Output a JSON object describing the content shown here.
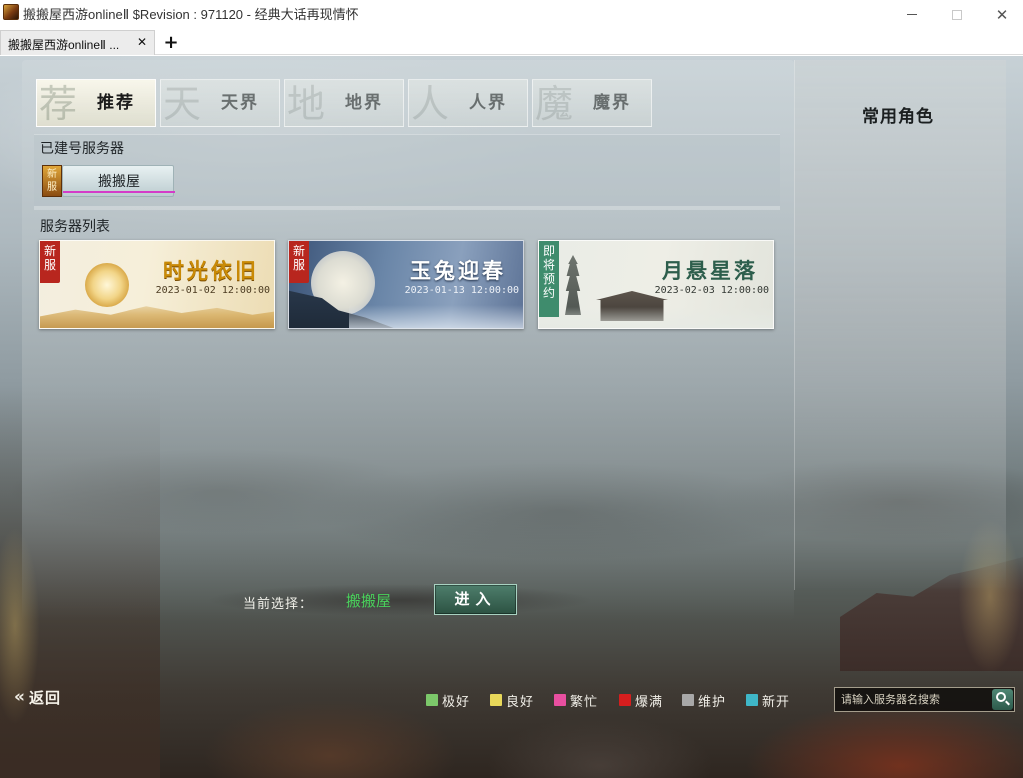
{
  "window": {
    "title": "搬搬屋西游onlineⅡ  $Revision : 971120 - 经典大话再现情怀",
    "minimize_icon": "minimize-icon",
    "maximize_icon": "maximize-icon",
    "close_glyph": "✕"
  },
  "tabs": [
    {
      "label": "搬搬屋西游onlineⅡ ...",
      "close": "✕"
    }
  ],
  "new_tab_glyph": "+",
  "realm_tabs": [
    {
      "watermark": "荐",
      "label": "推荐",
      "active": true
    },
    {
      "watermark": "天",
      "label": "天界",
      "active": false
    },
    {
      "watermark": "地",
      "label": "地界",
      "active": false
    },
    {
      "watermark": "人",
      "label": "人界",
      "active": false
    },
    {
      "watermark": "魔",
      "label": "魔界",
      "active": false
    }
  ],
  "built_section": {
    "title": "已建号服务器",
    "server": {
      "badge": "新服",
      "name": "搬搬屋"
    }
  },
  "list_section": {
    "title": "服务器列表",
    "servers": [
      {
        "badge": "新服",
        "badge_type": "new",
        "title": "时光依旧",
        "time": "2023-01-02 12:00:00"
      },
      {
        "badge": "新服",
        "badge_type": "new",
        "title": "玉兔迎春",
        "time": "2023-01-13 12:00:00"
      },
      {
        "badge": "即将预约",
        "badge_type": "soon",
        "title": "月悬星落",
        "time": "2023-02-03 12:00:00"
      }
    ]
  },
  "side_panel": {
    "title": "常用角色"
  },
  "selection": {
    "label": "当前选择：",
    "value": "搬搬屋",
    "enter_label": "进入"
  },
  "footer": {
    "back_icon": "«",
    "back_label": "返回",
    "legend": [
      {
        "label": "极好",
        "color": "#7cc86a"
      },
      {
        "label": "良好",
        "color": "#e8d85a"
      },
      {
        "label": "繁忙",
        "color": "#e84fa0"
      },
      {
        "label": "爆满",
        "color": "#d61e1e"
      },
      {
        "label": "维护",
        "color": "#a8a8a8"
      },
      {
        "label": "新开",
        "color": "#3fb7c8"
      }
    ],
    "search_placeholder": "请输入服务器名搜索"
  },
  "colors": {
    "accent_green": "#49d15b",
    "enter_button": "#3d6a59",
    "new_badge": "#b8261e",
    "soon_badge": "#3f8c6d",
    "chip_underline": "#d43bc8"
  }
}
